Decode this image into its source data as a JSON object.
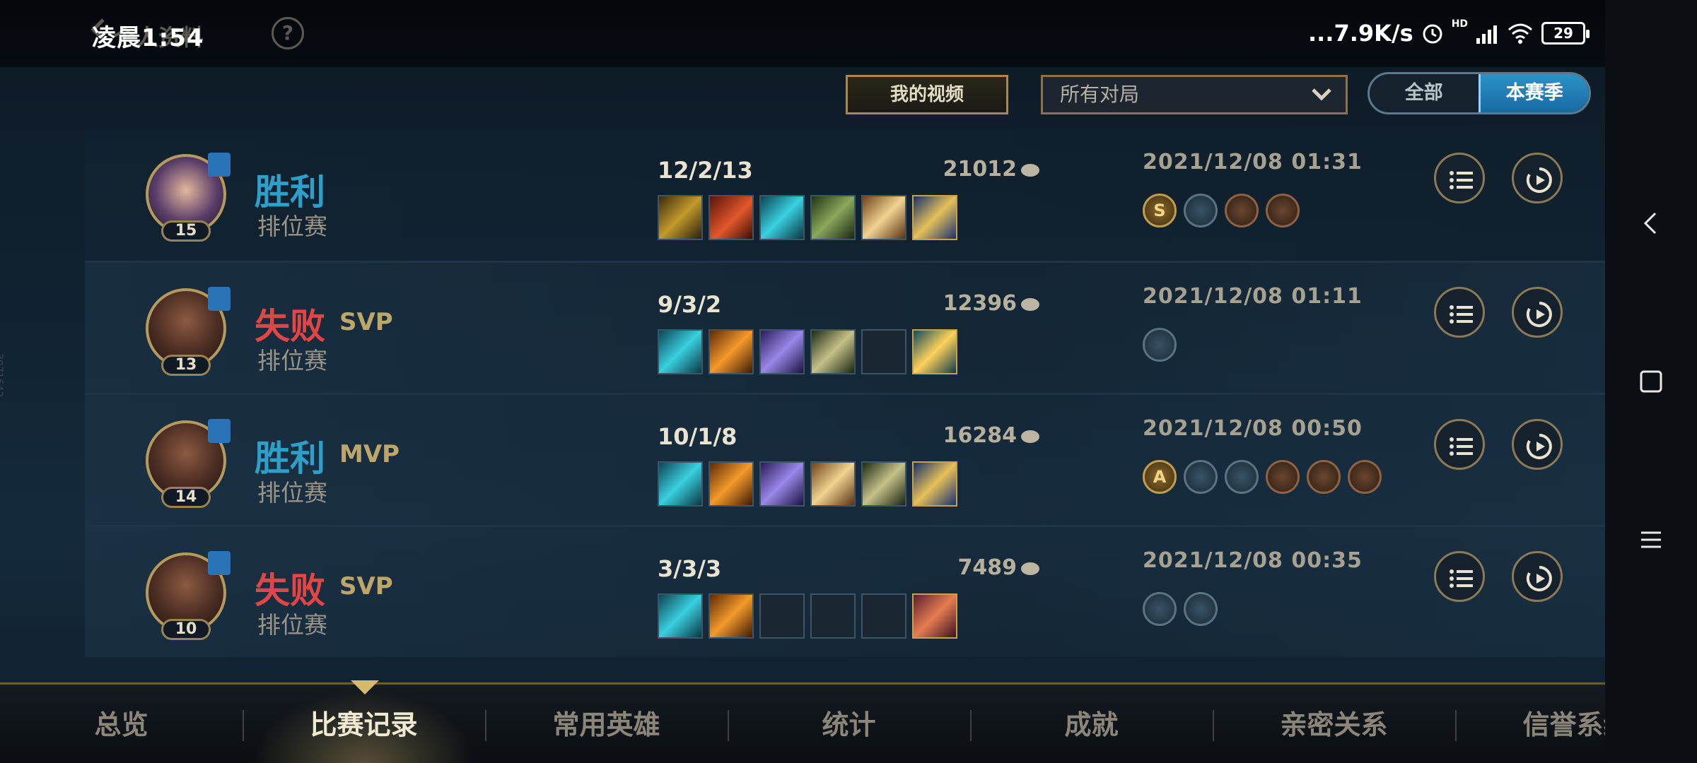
{
  "status_bar": {
    "time": "凌晨1:54",
    "network_speed": "...7.9K/s",
    "signal_label": "HD",
    "battery": "29"
  },
  "header": {
    "title": "个人资料",
    "help": "?"
  },
  "filters": {
    "my_video_button": "我的视频",
    "match_filter": "所有对局",
    "season_toggle": {
      "all": "全部",
      "this_season": "本赛季",
      "active": "this_season"
    }
  },
  "matches": [
    {
      "result": "胜利",
      "outcome": "win",
      "badge": "",
      "mode": "排位赛",
      "level": "15",
      "kda": "12/2/13",
      "gold": "21012",
      "time": "2021/12/08 01:31",
      "items": [
        "i-sword",
        "i-fire",
        "i-cyan",
        "i-green",
        "i-wing",
        "i-trophy"
      ],
      "medals": [
        {
          "type": "gold-m",
          "letter": "S"
        },
        {
          "type": "",
          "letter": ""
        },
        {
          "type": "bronze-m",
          "letter": ""
        },
        {
          "type": "bronze-m",
          "letter": ""
        }
      ]
    },
    {
      "result": "失败",
      "outcome": "loss",
      "badge": "SVP",
      "mode": "排位赛",
      "level": "13",
      "kda": "9/3/2",
      "gold": "12396",
      "time": "2021/12/08 01:11",
      "items": [
        "i-cyan",
        "i-orange",
        "i-purple",
        "i-staff",
        "",
        "i-boots"
      ],
      "medals": [
        {
          "type": "",
          "letter": ""
        }
      ]
    },
    {
      "result": "胜利",
      "outcome": "win",
      "badge": "MVP",
      "mode": "排位赛",
      "level": "14",
      "kda": "10/1/8",
      "gold": "16284",
      "time": "2021/12/08 00:50",
      "items": [
        "i-cyan",
        "i-orange",
        "i-purple",
        "i-wing",
        "i-staff",
        "i-trophy"
      ],
      "medals": [
        {
          "type": "gold-m",
          "letter": "A"
        },
        {
          "type": "",
          "letter": ""
        },
        {
          "type": "",
          "letter": ""
        },
        {
          "type": "bronze-m",
          "letter": ""
        },
        {
          "type": "bronze-m",
          "letter": ""
        },
        {
          "type": "bronze-m",
          "letter": ""
        }
      ]
    },
    {
      "result": "失败",
      "outcome": "loss",
      "badge": "SVP",
      "mode": "排位赛",
      "level": "10",
      "kda": "3/3/3",
      "gold": "7489",
      "time": "2021/12/08 00:35",
      "items": [
        "i-cyan",
        "i-orange",
        "",
        "",
        "",
        "i-beast"
      ],
      "medals": [
        {
          "type": "",
          "letter": ""
        },
        {
          "type": "",
          "letter": ""
        }
      ]
    }
  ],
  "bottom_nav": {
    "tabs": [
      "总览",
      "比赛记录",
      "常用英雄",
      "统计",
      "成就",
      "亲密关系",
      "信誉系统"
    ],
    "active_index": 1
  },
  "side_watermark": "3071642",
  "colors": {
    "win": "#2e9fc8",
    "loss": "#e34545",
    "gold_accent": "#bda667",
    "active_toggle": "#2b93c8"
  }
}
